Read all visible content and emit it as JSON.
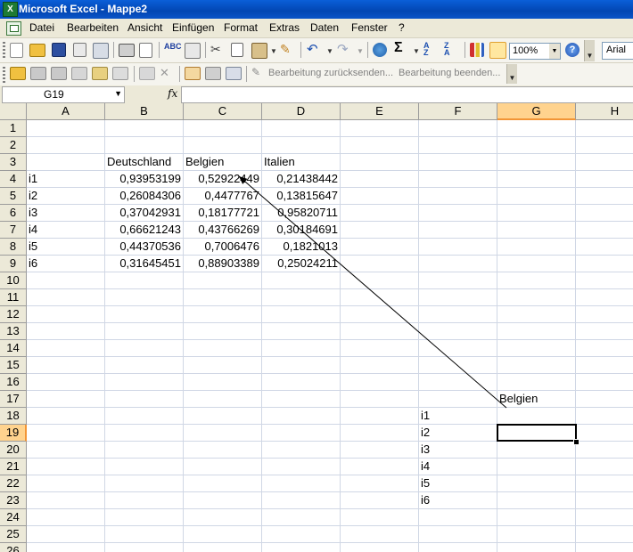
{
  "window": {
    "title": "Microsoft Excel - Mappe2"
  },
  "menu": [
    "Datei",
    "Bearbeiten",
    "Ansicht",
    "Einfügen",
    "Format",
    "Extras",
    "Daten",
    "Fenster",
    "?"
  ],
  "toolbar": {
    "zoom": "100%",
    "font": "Arial",
    "review_send": "Bearbeitung zurücksenden...",
    "review_end": "Bearbeitung beenden..."
  },
  "formula_bar": {
    "name_box": "G19",
    "fx": "fx",
    "content": ""
  },
  "sheet": {
    "columns": [
      "A",
      "B",
      "C",
      "D",
      "E",
      "F",
      "G",
      "H"
    ],
    "selected_column": "G",
    "rows": [
      "1",
      "2",
      "3",
      "4",
      "5",
      "6",
      "7",
      "8",
      "9",
      "10",
      "11",
      "12",
      "13",
      "14",
      "15",
      "16",
      "17",
      "18",
      "19",
      "20",
      "21",
      "22",
      "23",
      "24",
      "25",
      "26"
    ],
    "selected_row": "19",
    "cells": [
      {
        "ref": "B3",
        "value": "Deutschland",
        "type": "text"
      },
      {
        "ref": "C3",
        "value": "Belgien",
        "type": "text"
      },
      {
        "ref": "D3",
        "value": "Italien",
        "type": "text"
      },
      {
        "ref": "A4",
        "value": "i1",
        "type": "text"
      },
      {
        "ref": "B4",
        "value": "0,93953199",
        "type": "num"
      },
      {
        "ref": "C4",
        "value": "0,52922449",
        "type": "num"
      },
      {
        "ref": "D4",
        "value": "0,21438442",
        "type": "num"
      },
      {
        "ref": "A5",
        "value": "i2",
        "type": "text"
      },
      {
        "ref": "B5",
        "value": "0,26084306",
        "type": "num"
      },
      {
        "ref": "C5",
        "value": "0,4477767",
        "type": "num"
      },
      {
        "ref": "D5",
        "value": "0,13815647",
        "type": "num"
      },
      {
        "ref": "A6",
        "value": "i3",
        "type": "text"
      },
      {
        "ref": "B6",
        "value": "0,37042931",
        "type": "num"
      },
      {
        "ref": "C6",
        "value": "0,18177721",
        "type": "num"
      },
      {
        "ref": "D6",
        "value": "0,95820711",
        "type": "num"
      },
      {
        "ref": "A7",
        "value": "i4",
        "type": "text"
      },
      {
        "ref": "B7",
        "value": "0,66621243",
        "type": "num"
      },
      {
        "ref": "C7",
        "value": "0,43766269",
        "type": "num"
      },
      {
        "ref": "D7",
        "value": "0,30184691",
        "type": "num"
      },
      {
        "ref": "A8",
        "value": "i5",
        "type": "text"
      },
      {
        "ref": "B8",
        "value": "0,44370536",
        "type": "num"
      },
      {
        "ref": "C8",
        "value": "0,7006476",
        "type": "num"
      },
      {
        "ref": "D8",
        "value": "0,1821013",
        "type": "num"
      },
      {
        "ref": "A9",
        "value": "i6",
        "type": "text"
      },
      {
        "ref": "B9",
        "value": "0,31645451",
        "type": "num"
      },
      {
        "ref": "C9",
        "value": "0,88903389",
        "type": "num"
      },
      {
        "ref": "D9",
        "value": "0,25024211",
        "type": "num"
      },
      {
        "ref": "G17",
        "value": "Belgien",
        "type": "text"
      },
      {
        "ref": "F18",
        "value": "i1",
        "type": "text"
      },
      {
        "ref": "F19",
        "value": "i2",
        "type": "text"
      },
      {
        "ref": "F20",
        "value": "i3",
        "type": "text"
      },
      {
        "ref": "F21",
        "value": "i4",
        "type": "text"
      },
      {
        "ref": "F22",
        "value": "i5",
        "type": "text"
      },
      {
        "ref": "F23",
        "value": "i6",
        "type": "text"
      }
    ],
    "active_cell": "G19",
    "arrow": {
      "from": "G17",
      "to": "C4"
    }
  },
  "colors": {
    "title_bar": "#0246b3",
    "selection_header": "#ffd38e",
    "grid_line": "#d0d7e5"
  }
}
